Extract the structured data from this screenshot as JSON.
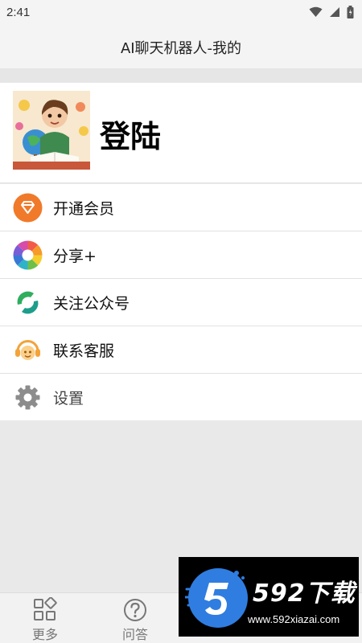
{
  "status_bar": {
    "time": "2:41",
    "icons": [
      "wifi-icon",
      "signal-icon",
      "battery-icon"
    ]
  },
  "header": {
    "title": "AI聊天机器人-我的"
  },
  "profile": {
    "login_label": "登陆",
    "avatar": "avatar-boy-with-globe"
  },
  "menu": {
    "items": [
      {
        "label": "开通会员",
        "icon": "diamond-icon",
        "color": "#f07a2a"
      },
      {
        "label": "分享+",
        "icon": "share-icon",
        "color": "#7b5cd6"
      },
      {
        "label": "关注公众号",
        "icon": "official-account-icon",
        "color": "#2fae5f"
      },
      {
        "label": "联系客服",
        "icon": "customer-service-icon",
        "color": "#f3a33a"
      },
      {
        "label": "设置",
        "icon": "gear-icon",
        "color": "#8c8c8c"
      }
    ]
  },
  "bottom_nav": {
    "items": [
      {
        "label": "更多",
        "icon": "grid-icon"
      },
      {
        "label": "问答",
        "icon": "question-icon"
      }
    ]
  },
  "watermark": {
    "brand": "592下载",
    "url": "www.592xiazai.com"
  }
}
